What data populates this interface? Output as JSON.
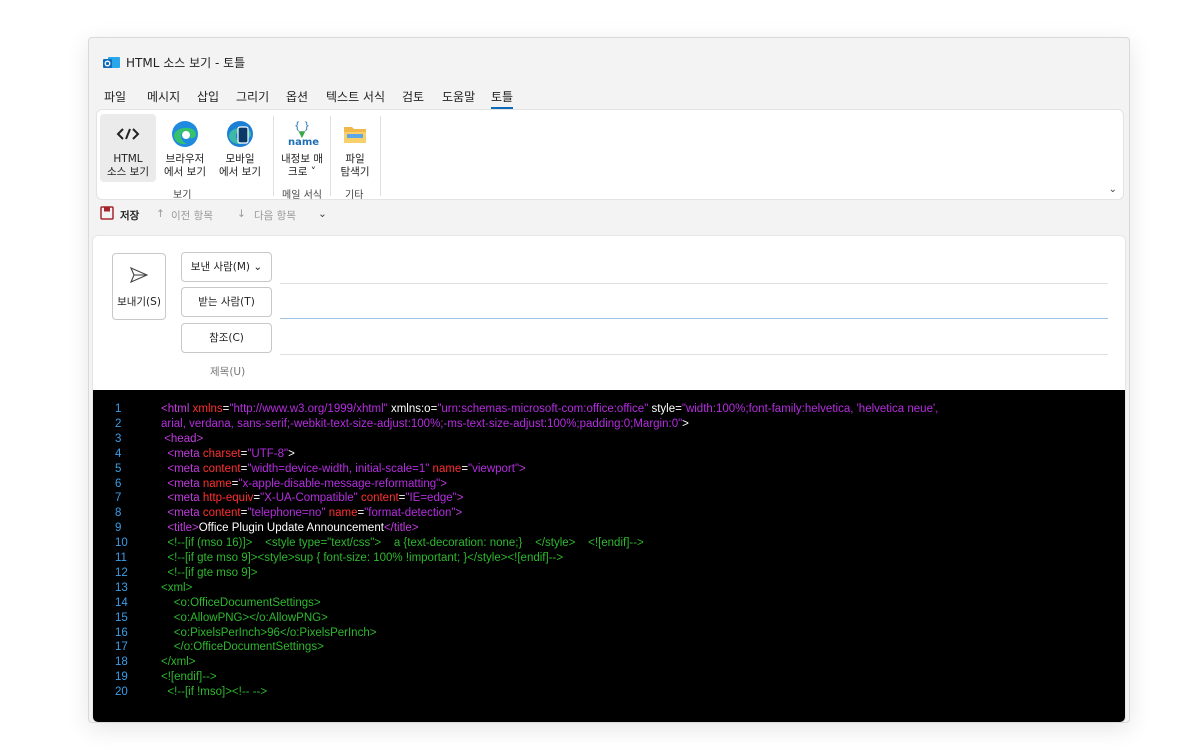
{
  "window": {
    "title": "HTML 소스 보기 - 토틀"
  },
  "menu": [
    "파일",
    "메시지",
    "삽입",
    "그리기",
    "옵션",
    "텍스트 서식",
    "검토",
    "도움말",
    "토틀"
  ],
  "ribbon": {
    "buttons": {
      "html_source": "HTML\n소스 보기",
      "browser_view": "브라우저\n에서 보기",
      "mobile_view": "모바일\n에서 보기",
      "name_macro": "내정보 매\n크로 ˅",
      "file_explorer": "파일\n탐색기",
      "name_icon_text": "name",
      "braces_icon_text": "{ }"
    },
    "groups": {
      "view": "보기",
      "mail_format": "메일 서식",
      "other": "기타"
    }
  },
  "qat": {
    "save": "저장",
    "prev": "이전 항목",
    "next": "다음 항목"
  },
  "compose": {
    "send": "보내기(S)",
    "from": "보낸 사람(M)",
    "to": "받는 사람(T)",
    "cc": "참조(C)",
    "subject": "제목(U)"
  },
  "code_lines": [
    {
      "n": "1",
      "segs": [
        [
          "tag",
          "<html "
        ],
        [
          "attr",
          "xmlns"
        ],
        [
          "white",
          "="
        ],
        [
          "val",
          "\"http://www.w3.org/1999/xhtml\""
        ],
        [
          "white",
          " xmlns:o"
        ],
        [
          "white",
          "="
        ],
        [
          "val",
          "\"urn:schemas-microsoft-com:office:office\""
        ],
        [
          "white",
          " style"
        ],
        [
          "white",
          "="
        ],
        [
          "val",
          "\"width:100%;font-family:helvetica, 'helvetica neue',"
        ]
      ]
    },
    {
      "n": "2",
      "segs": [
        [
          "val",
          "arial, verdana, sans-serif;-webkit-text-size-adjust:100%;-ms-text-size-adjust:100%;padding:0;Margin:0\""
        ],
        [
          "white",
          ">"
        ]
      ]
    },
    {
      "n": "3",
      "segs": [
        [
          "tag",
          " <head>"
        ]
      ]
    },
    {
      "n": "4",
      "segs": [
        [
          "tag",
          "  <meta "
        ],
        [
          "attr",
          "charset"
        ],
        [
          "white",
          "="
        ],
        [
          "val",
          "\"UTF-8\""
        ],
        [
          "white",
          ">"
        ]
      ]
    },
    {
      "n": "5",
      "segs": [
        [
          "tag",
          "  <meta "
        ],
        [
          "attr",
          "content"
        ],
        [
          "white",
          "="
        ],
        [
          "val",
          "\"width=device-width, initial-scale=1\""
        ],
        [
          "attr",
          " name"
        ],
        [
          "white",
          "="
        ],
        [
          "val",
          "\"viewport\""
        ],
        [
          "tag",
          ">"
        ]
      ]
    },
    {
      "n": "6",
      "segs": [
        [
          "tag",
          "  <meta "
        ],
        [
          "attr",
          "name"
        ],
        [
          "white",
          "="
        ],
        [
          "val",
          "\"x-apple-disable-message-reformatting\""
        ],
        [
          "tag",
          ">"
        ]
      ]
    },
    {
      "n": "7",
      "segs": [
        [
          "tag",
          "  <meta "
        ],
        [
          "attr",
          "http-equiv"
        ],
        [
          "white",
          "="
        ],
        [
          "val",
          "\"X-UA-Compatible\""
        ],
        [
          "attr",
          " content"
        ],
        [
          "white",
          "="
        ],
        [
          "val",
          "\"IE=edge\""
        ],
        [
          "tag",
          ">"
        ]
      ]
    },
    {
      "n": "8",
      "segs": [
        [
          "tag",
          "  <meta "
        ],
        [
          "attr",
          "content"
        ],
        [
          "white",
          "="
        ],
        [
          "val",
          "\"telephone=no\""
        ],
        [
          "attr",
          " name"
        ],
        [
          "white",
          "="
        ],
        [
          "val",
          "\"format-detection\""
        ],
        [
          "tag",
          ">"
        ]
      ]
    },
    {
      "n": "9",
      "segs": [
        [
          "tag",
          "  <title>"
        ],
        [
          "white",
          "Office Plugin Update Announcement"
        ],
        [
          "tag",
          "</title>"
        ]
      ]
    },
    {
      "n": "10",
      "segs": [
        [
          "cmt",
          "  <!--[if (mso 16)]>    <style type=\"text/css\">    a {text-decoration: none;}    </style>    <![endif]-->"
        ]
      ]
    },
    {
      "n": "11",
      "segs": [
        [
          "cmt",
          "  <!--[if gte mso 9]><style>sup { font-size: 100% !important; }</style><![endif]-->"
        ]
      ]
    },
    {
      "n": "12",
      "segs": [
        [
          "cmt",
          "  <!--[if gte mso 9]>"
        ]
      ]
    },
    {
      "n": "13",
      "segs": [
        [
          "cmt",
          "<xml>"
        ]
      ]
    },
    {
      "n": "14",
      "segs": [
        [
          "cmt",
          "    <o:OfficeDocumentSettings>"
        ]
      ]
    },
    {
      "n": "15",
      "segs": [
        [
          "cmt",
          "    <o:AllowPNG></o:AllowPNG>"
        ]
      ]
    },
    {
      "n": "16",
      "segs": [
        [
          "cmt",
          "    <o:PixelsPerInch>96</o:PixelsPerInch>"
        ]
      ]
    },
    {
      "n": "17",
      "segs": [
        [
          "cmt",
          "    </o:OfficeDocumentSettings>"
        ]
      ]
    },
    {
      "n": "18",
      "segs": [
        [
          "cmt",
          "</xml>"
        ]
      ]
    },
    {
      "n": "19",
      "segs": [
        [
          "cmt",
          "<![endif]-->"
        ]
      ]
    },
    {
      "n": "20",
      "segs": [
        [
          "cmt",
          "  <!--[if !mso]><!-- -->"
        ]
      ]
    }
  ]
}
